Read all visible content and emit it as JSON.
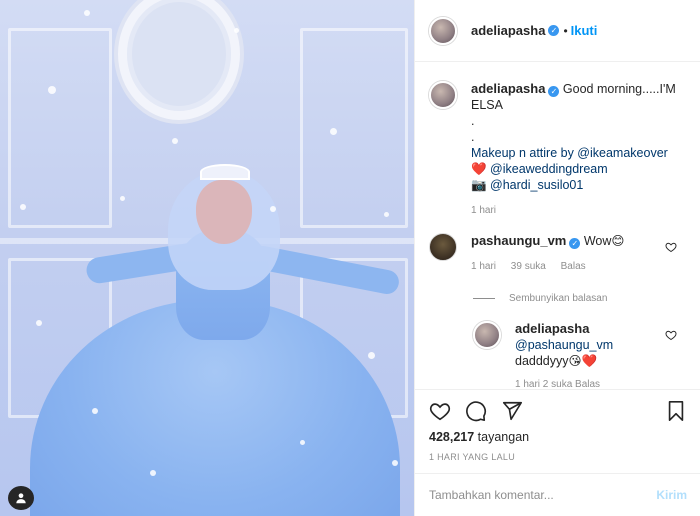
{
  "post": {
    "username": "adeliapasha",
    "follow_label": "Ikuti",
    "dot": "•"
  },
  "caption": {
    "username": "adeliapasha",
    "lines": [
      "Good morning.....I'M",
      "ELSA",
      ".",
      ".",
      "Makeup n attire by @ikeamakeover",
      "❤️ @ikeaweddingdream",
      "📷 @hardi_susilo01"
    ],
    "time": "1 hari"
  },
  "comment": {
    "username": "pashaungu_vm",
    "text": "Wow😊",
    "time": "1 hari",
    "likes": "39 suka",
    "reply_label": "Balas"
  },
  "hide_replies_label": "Sembunyikan balasan",
  "reply": {
    "username": "adeliapasha",
    "mention": "@pashaungu_vm",
    "text": "dadddyyy😘❤️",
    "meta": "1 hari  2 suka  Balas"
  },
  "stats": {
    "views_count": "428,217",
    "views_label": "tayangan",
    "date": "1 HARI YANG LALU"
  },
  "comment_box": {
    "placeholder": "Tambahkan komentar...",
    "post_label": "Kirim"
  },
  "icons": {
    "like": "heart-icon",
    "comment": "comment-icon",
    "share": "share-icon",
    "save": "bookmark-icon",
    "verified": "verified-badge-icon",
    "audio": "audio-icon"
  },
  "colors": {
    "accent": "#0095f6",
    "verified": "#3897f0",
    "muted": "#8e8e8e"
  }
}
